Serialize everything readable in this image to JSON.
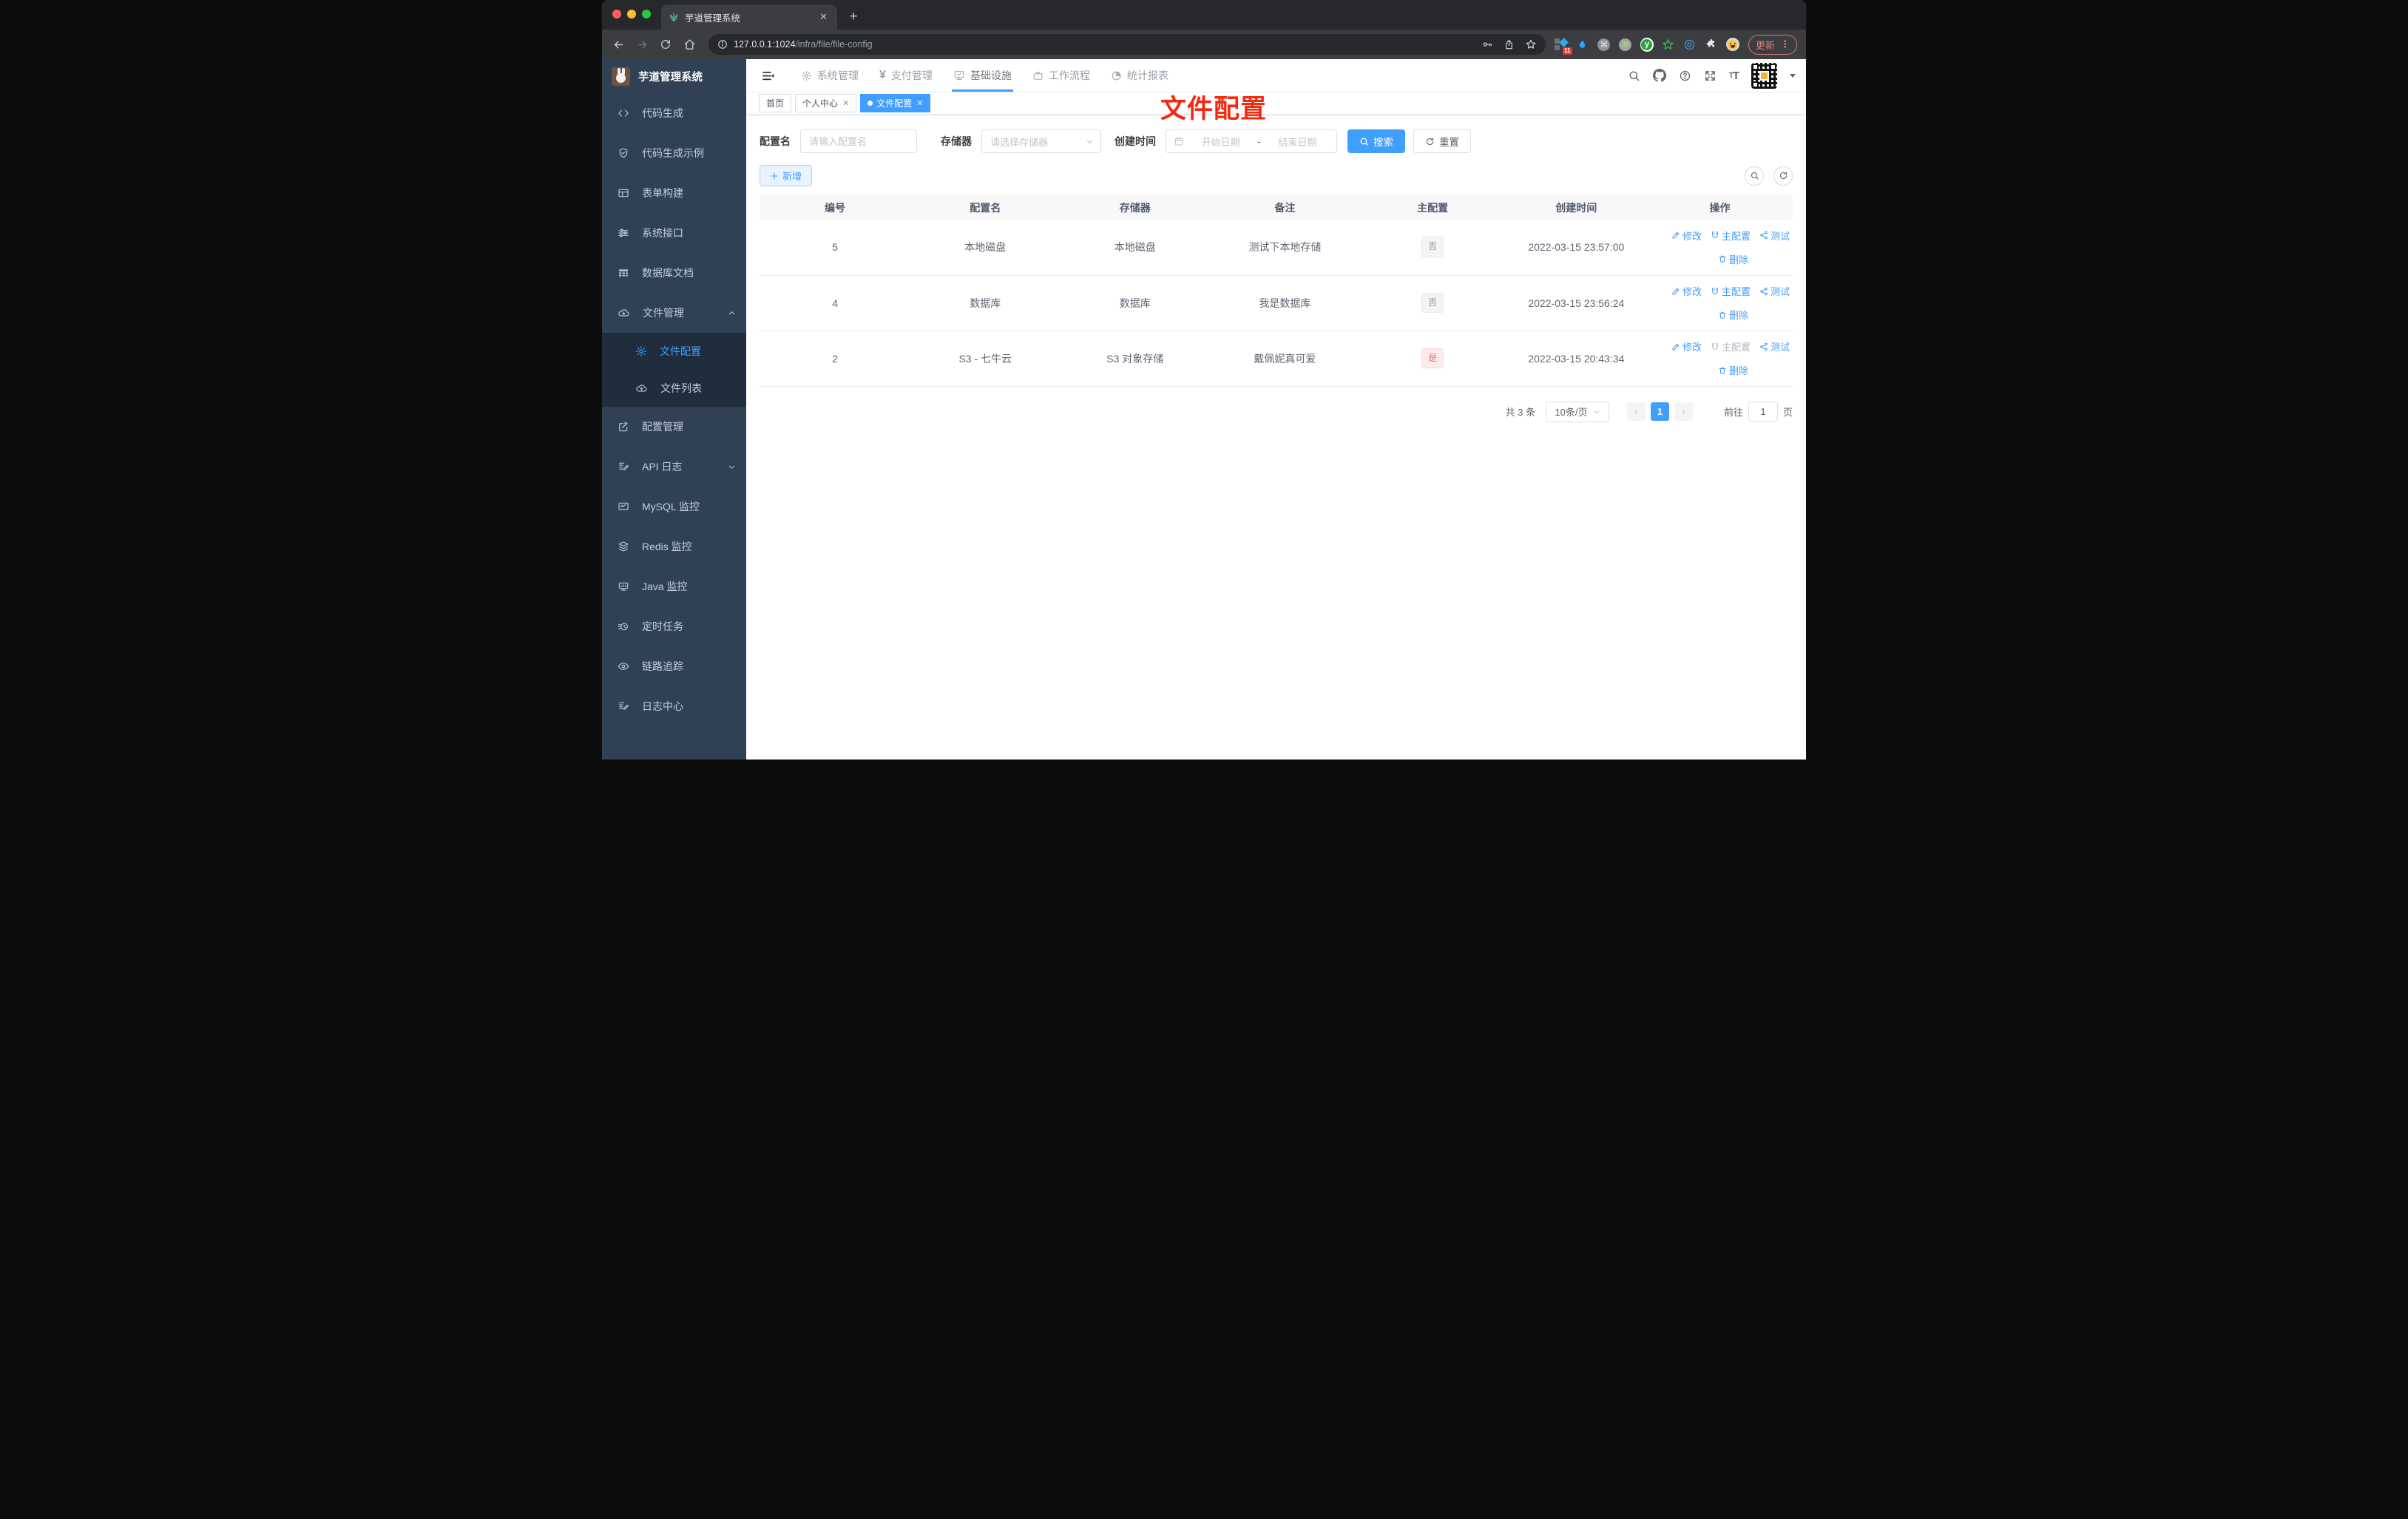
{
  "browser": {
    "tab_title": "芋道管理系统",
    "new_tab": "+",
    "close_tab": "✕",
    "url_host": "127.0.0.1:1024",
    "url_path": "/infra/file/file-config",
    "extension_badge": "11",
    "command_glyph": "⌘",
    "y_extension_glyph": "y",
    "update_button": "更新",
    "menu_dots": "⋮"
  },
  "sidebar": {
    "title": "芋道管理系统",
    "items": [
      {
        "label": "代码生成",
        "icon": "code-icon"
      },
      {
        "label": "代码生成示例",
        "icon": "shield-check-icon"
      },
      {
        "label": "表单构建",
        "icon": "form-icon"
      },
      {
        "label": "系统接口",
        "icon": "sliders-icon"
      },
      {
        "label": "数据库文档",
        "icon": "grid-icon"
      },
      {
        "label": "文件管理",
        "icon": "cloud-download-icon",
        "expanded": true
      },
      {
        "label": "文件配置",
        "icon": "gear-icon",
        "active": true,
        "submenu": true
      },
      {
        "label": "文件列表",
        "icon": "cloud-upload-icon",
        "submenu": true
      },
      {
        "label": "配置管理",
        "icon": "edit-square-icon"
      },
      {
        "label": "API 日志",
        "icon": "log-edit-icon",
        "collapsed": true
      },
      {
        "label": "MySQL 监控",
        "icon": "monitor-chart-icon"
      },
      {
        "label": "Redis 监控",
        "icon": "layers-icon"
      },
      {
        "label": "Java 监控",
        "icon": "monitor-icon"
      },
      {
        "label": "定时任务",
        "icon": "timer-icon"
      },
      {
        "label": "链路追踪",
        "icon": "eye-icon"
      },
      {
        "label": "日志中心",
        "icon": "log-edit-icon"
      }
    ]
  },
  "header": {
    "menus": [
      {
        "label": "系统管理",
        "icon": "gear-icon"
      },
      {
        "label": "支付管理",
        "icon": "yen-icon",
        "yen": "¥"
      },
      {
        "label": "基础设施",
        "icon": "monitor-check-icon",
        "active": true
      },
      {
        "label": "工作流程",
        "icon": "briefcase-icon"
      },
      {
        "label": "统计报表",
        "icon": "pie-chart-icon"
      }
    ],
    "font_size_glyph": "T"
  },
  "tags": [
    {
      "label": "首页"
    },
    {
      "label": "个人中心",
      "closable": true
    },
    {
      "label": "文件配置",
      "closable": true,
      "active": true
    }
  ],
  "annotation": {
    "text": "文件配置",
    "color": "#f5290f"
  },
  "filters": {
    "name_label": "配置名",
    "name_placeholder": "请输入配置名",
    "storage_label": "存储器",
    "storage_placeholder": "请选择存储器",
    "date_label": "创建时间",
    "date_start_placeholder": "开始日期",
    "date_separator": "-",
    "date_end_placeholder": "结束日期",
    "search_button": "搜索",
    "reset_button": "重置"
  },
  "actions_bar": {
    "add_button": "新增"
  },
  "table": {
    "headers": [
      "编号",
      "配置名",
      "存储器",
      "备注",
      "主配置",
      "创建时间",
      "操作"
    ],
    "rows": [
      {
        "id": "5",
        "name": "本地磁盘",
        "storage": "本地磁盘",
        "remark": "测试下本地存储",
        "master": "否",
        "created": "2022-03-15 23:57:00"
      },
      {
        "id": "4",
        "name": "数据库",
        "storage": "数据库",
        "remark": "我是数据库",
        "master": "否",
        "created": "2022-03-15 23:56:24"
      },
      {
        "id": "2",
        "name": "S3 - 七牛云",
        "storage": "S3 对象存储",
        "remark": "戴佩妮真可爱",
        "master": "是",
        "created": "2022-03-15 20:43:34"
      }
    ],
    "actions": {
      "edit": "修改",
      "master": "主配置",
      "test": "测试",
      "delete": "删除"
    }
  },
  "pagination": {
    "total": "共 3 条",
    "page_size": "10条/页",
    "prev_glyph": "‹",
    "current_page": "1",
    "next_glyph": "›",
    "goto_label": "前往",
    "goto_value": "1",
    "page_unit": "页"
  },
  "colors": {
    "primary": "#409eff",
    "sidebar_bg": "#304156",
    "submenu_bg": "#1f2d3d",
    "danger": "#f56c6c",
    "annotation_red": "#f5290f",
    "tag_info_text": "#909399"
  }
}
